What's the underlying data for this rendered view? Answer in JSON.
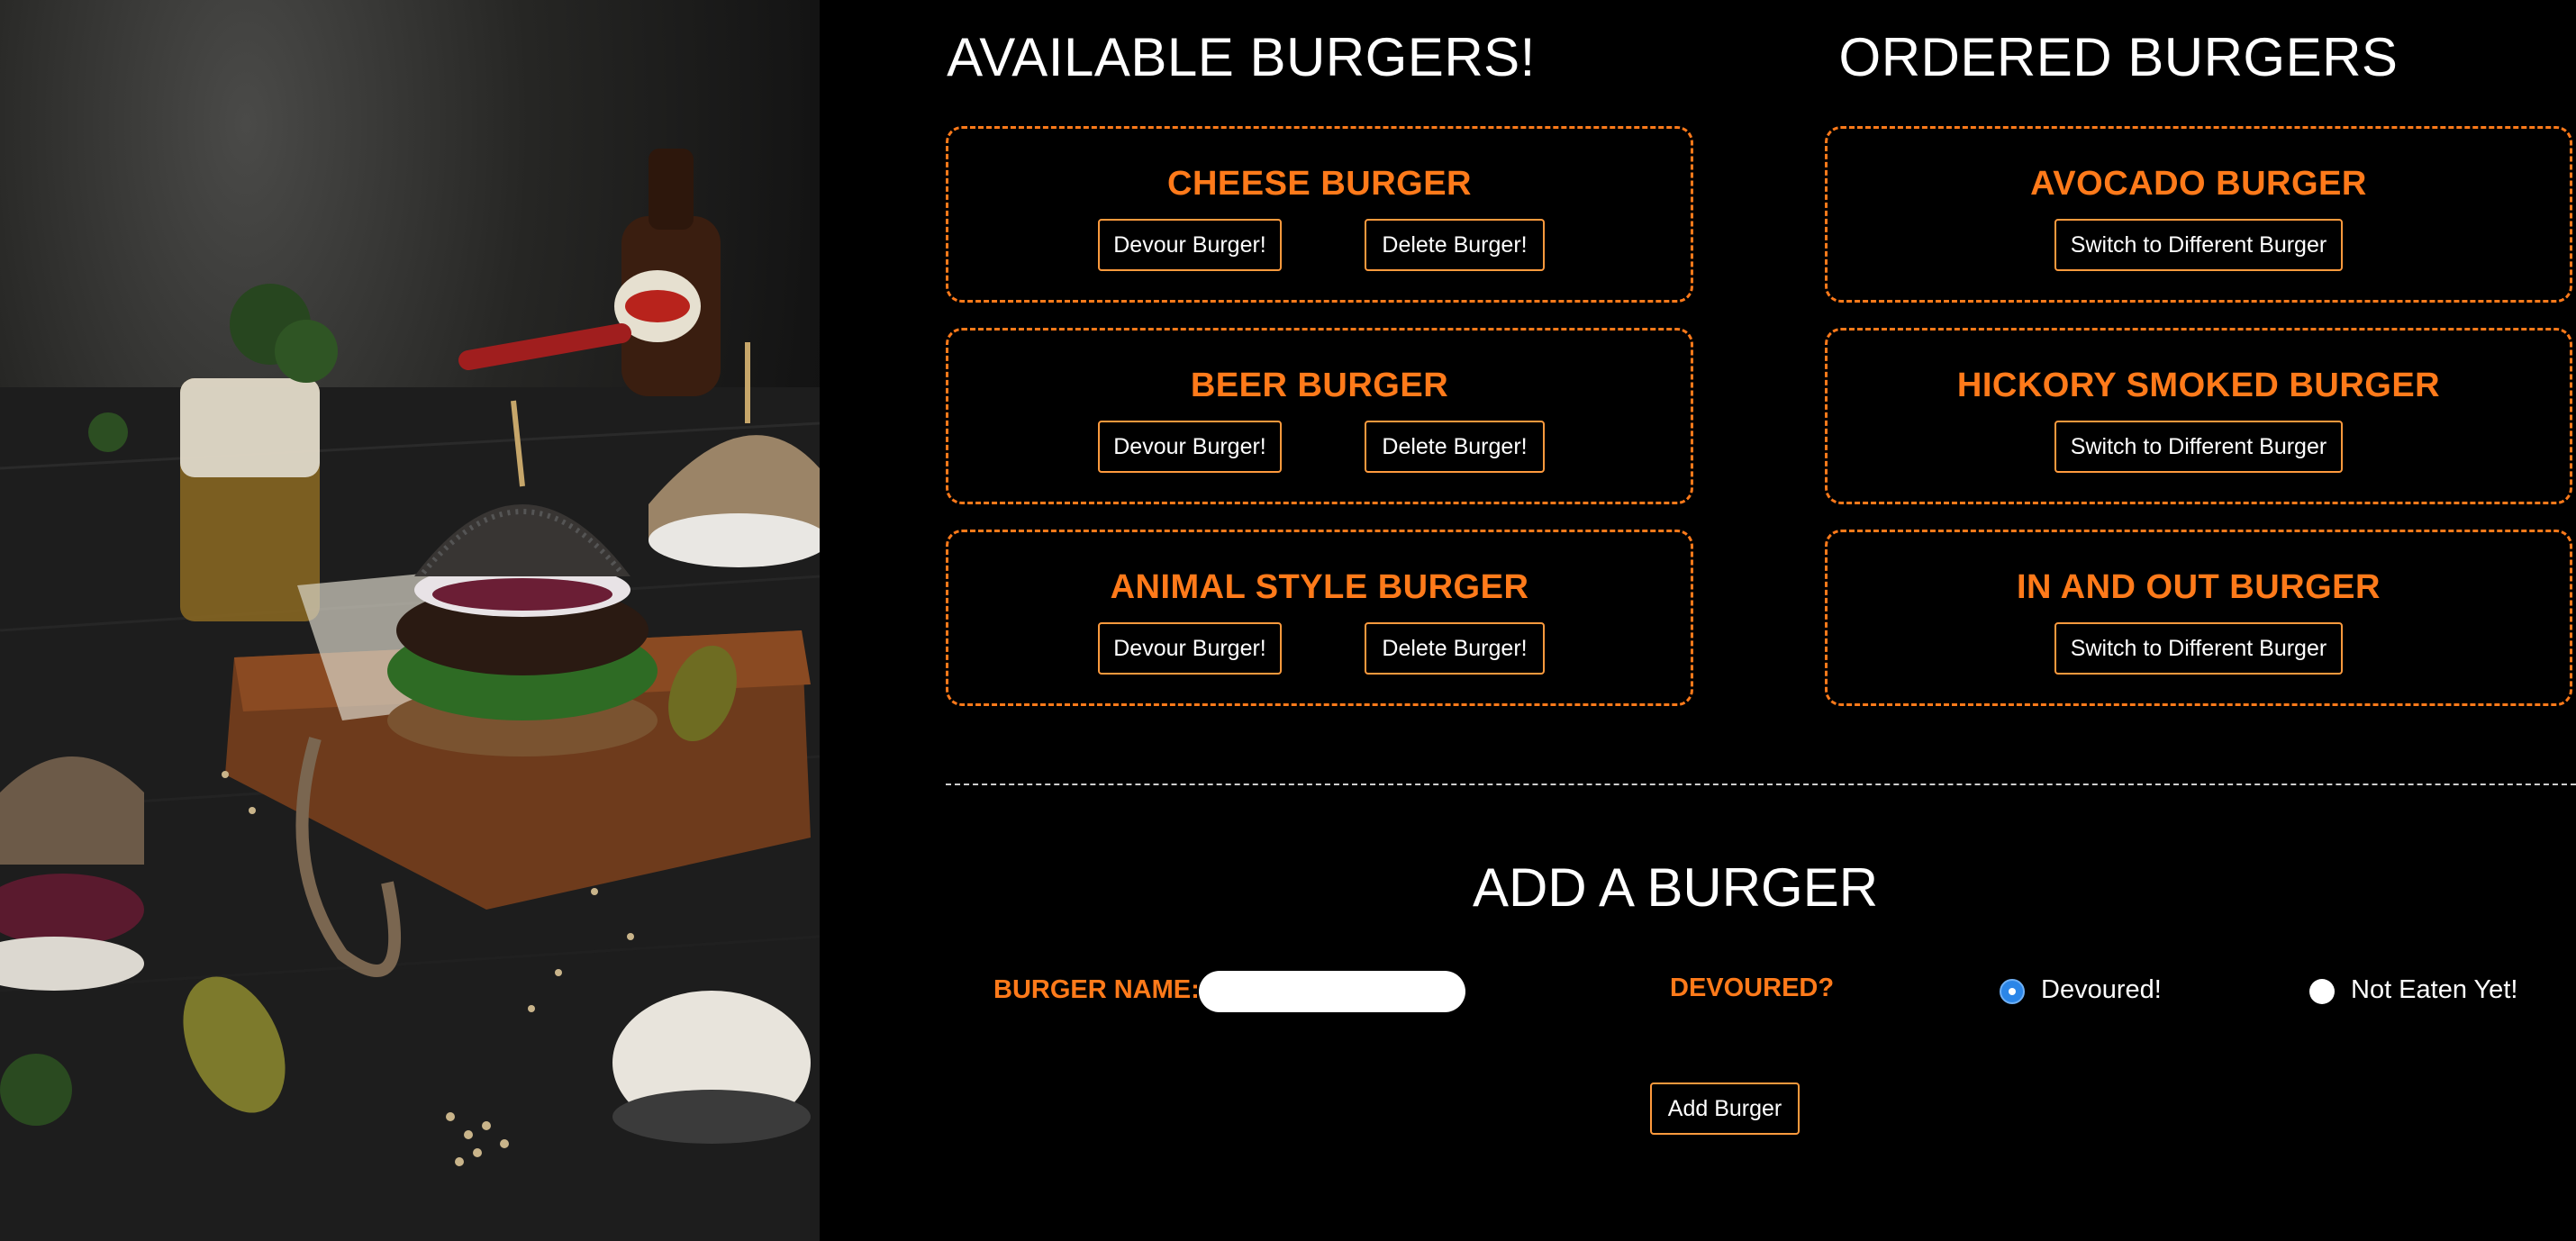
{
  "available": {
    "title": "AVAILABLE BURGERS!",
    "devour_label": "Devour Burger!",
    "delete_label": "Delete Burger!",
    "items": [
      {
        "name": "CHEESE BURGER"
      },
      {
        "name": "BEER BURGER"
      },
      {
        "name": "ANIMAL STYLE BURGER"
      }
    ]
  },
  "ordered": {
    "title": "ORDERED BURGERS",
    "switch_label": "Switch to Different Burger",
    "items": [
      {
        "name": "AVOCADO BURGER"
      },
      {
        "name": "HICKORY SMOKED BURGER"
      },
      {
        "name": "IN AND OUT BURGER"
      }
    ]
  },
  "add_form": {
    "title": "ADD A BURGER",
    "name_label": "BURGER NAME:",
    "name_value": "",
    "devoured_label": "DEVOURED?",
    "radio_devoured_label": "Devoured!",
    "radio_not_eaten_label": "Not Eaten Yet!",
    "selected": "Devoured!",
    "submit_label": "Add Burger"
  },
  "colors": {
    "accent": "#ff7a1a",
    "background": "#000000",
    "radio_selected": "#2b86e8"
  }
}
